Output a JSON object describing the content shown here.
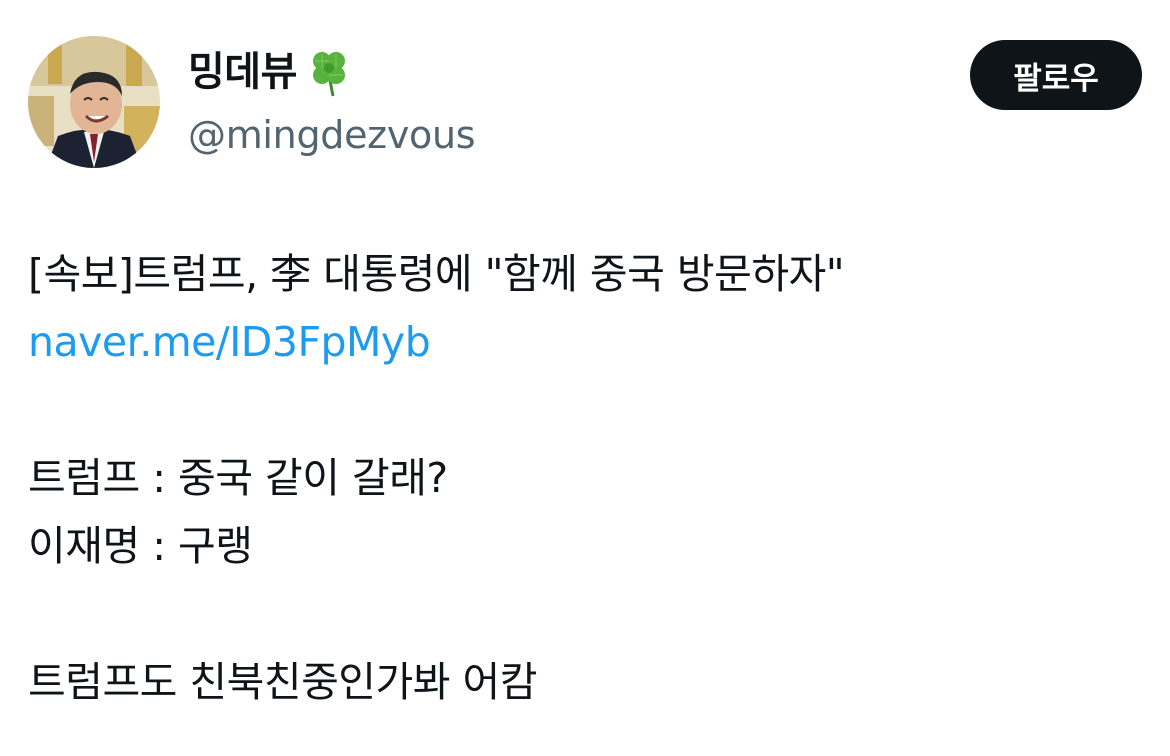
{
  "author": {
    "display_name": "밍데뷰",
    "handle": "@mingdezvous",
    "emoji_icon": "four-leaf-clover-icon"
  },
  "follow_button": {
    "label": "팔로우"
  },
  "tweet": {
    "headline": "[속보]트럼프, 李 대통령에 \"함께 중국 방문하자\"",
    "link_text": "naver.me/ID3FpMyb",
    "dialogue_line_1": "트럼프 : 중국 같이 갈래?",
    "dialogue_line_2": "이재명 : 구랭",
    "closing_line": "트럼프도 친북친중인가봐 어캄"
  },
  "colors": {
    "link": "#1d9bf0",
    "text": "#0f1419",
    "handle": "#536471",
    "follow_bg": "#0f1419"
  }
}
